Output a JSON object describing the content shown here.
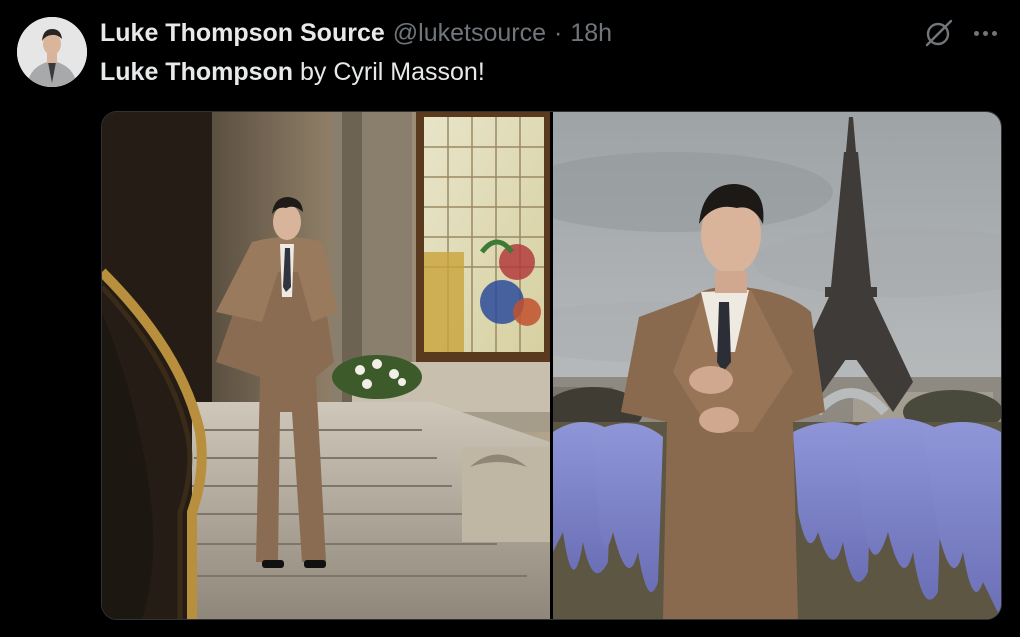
{
  "author": {
    "display_name": "Luke Thompson Source",
    "handle": "@luketsource",
    "separator": "·",
    "timestamp": "18h"
  },
  "tweet": {
    "text_bold": "Luke Thompson",
    "text_rest": " by Cyril Masson!"
  },
  "icons": {
    "grok": "grok-icon",
    "more": "more-horizontal-icon"
  },
  "media": {
    "photos": [
      {
        "name": "photo-staircase"
      },
      {
        "name": "photo-eiffel-tower"
      }
    ]
  }
}
